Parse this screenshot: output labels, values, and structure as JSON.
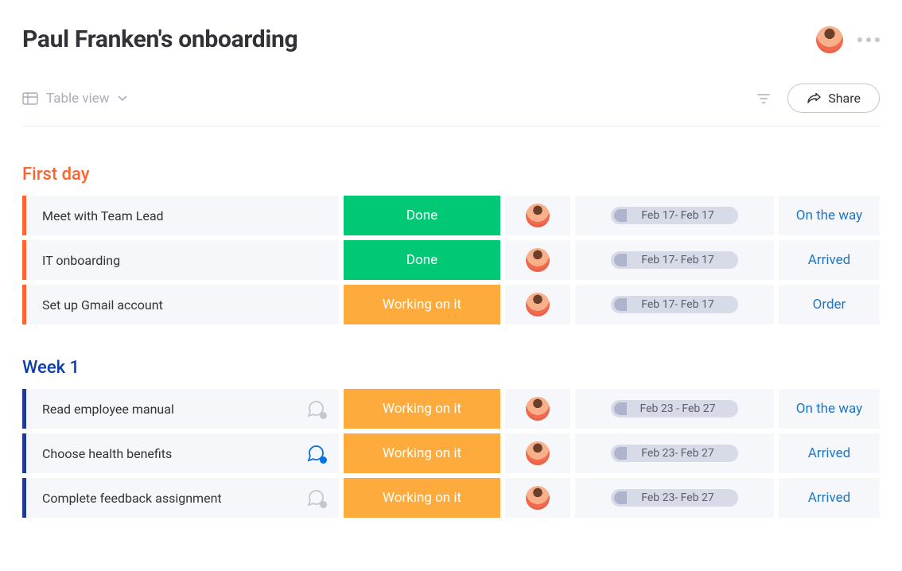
{
  "header": {
    "title": "Paul Franken's onboarding"
  },
  "toolbar": {
    "view_label": "Table view",
    "share_label": "Share"
  },
  "groups": [
    {
      "id": "first-day",
      "title": "First day",
      "rows": [
        {
          "name": "Meet with Team Lead",
          "status": "Done",
          "status_type": "done",
          "date": "Feb 17- Feb 17",
          "action": "On the way",
          "chat": "none"
        },
        {
          "name": "IT onboarding",
          "status": "Done",
          "status_type": "done",
          "date": "Feb 17- Feb 17",
          "action": "Arrived",
          "chat": "none"
        },
        {
          "name": "Set up Gmail account",
          "status": "Working on it",
          "status_type": "working",
          "date": "Feb 17- Feb 17",
          "action": "Order",
          "chat": "none"
        }
      ]
    },
    {
      "id": "week1",
      "title": "Week 1",
      "rows": [
        {
          "name": "Read employee manual",
          "status": "Working on it",
          "status_type": "working",
          "date": "Feb 23 - Feb 27",
          "action": "On the way",
          "chat": "empty"
        },
        {
          "name": "Choose health benefits",
          "status": "Working on it",
          "status_type": "working",
          "date": "Feb 23- Feb 27",
          "action": "Arrived",
          "chat": "active"
        },
        {
          "name": "Complete feedback assignment",
          "status": "Working on it",
          "status_type": "working",
          "date": "Feb 23- Feb 27",
          "action": "Arrived",
          "chat": "empty"
        }
      ]
    }
  ]
}
